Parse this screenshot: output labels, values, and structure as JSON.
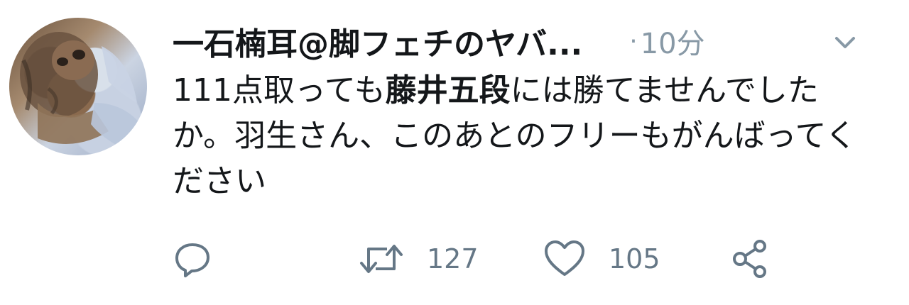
{
  "tweet": {
    "author_name": "一石楠耳@脚フェチのヤバ...",
    "separator": "·",
    "time": "10分",
    "text_part1": "111点取っても",
    "text_bold": "藤井五段",
    "text_part2": "には勝てませんでしたか。羽生さん、このあとのフリーもがんばってください",
    "retweet_count": "127",
    "like_count": "105"
  },
  "icons": {
    "reply": "reply-icon",
    "retweet": "retweet-icon",
    "like": "heart-icon",
    "share": "share-icon",
    "more": "chevron-down-icon"
  },
  "colors": {
    "text": "#14171a",
    "muted": "#8899a6",
    "icon": "#657786"
  }
}
